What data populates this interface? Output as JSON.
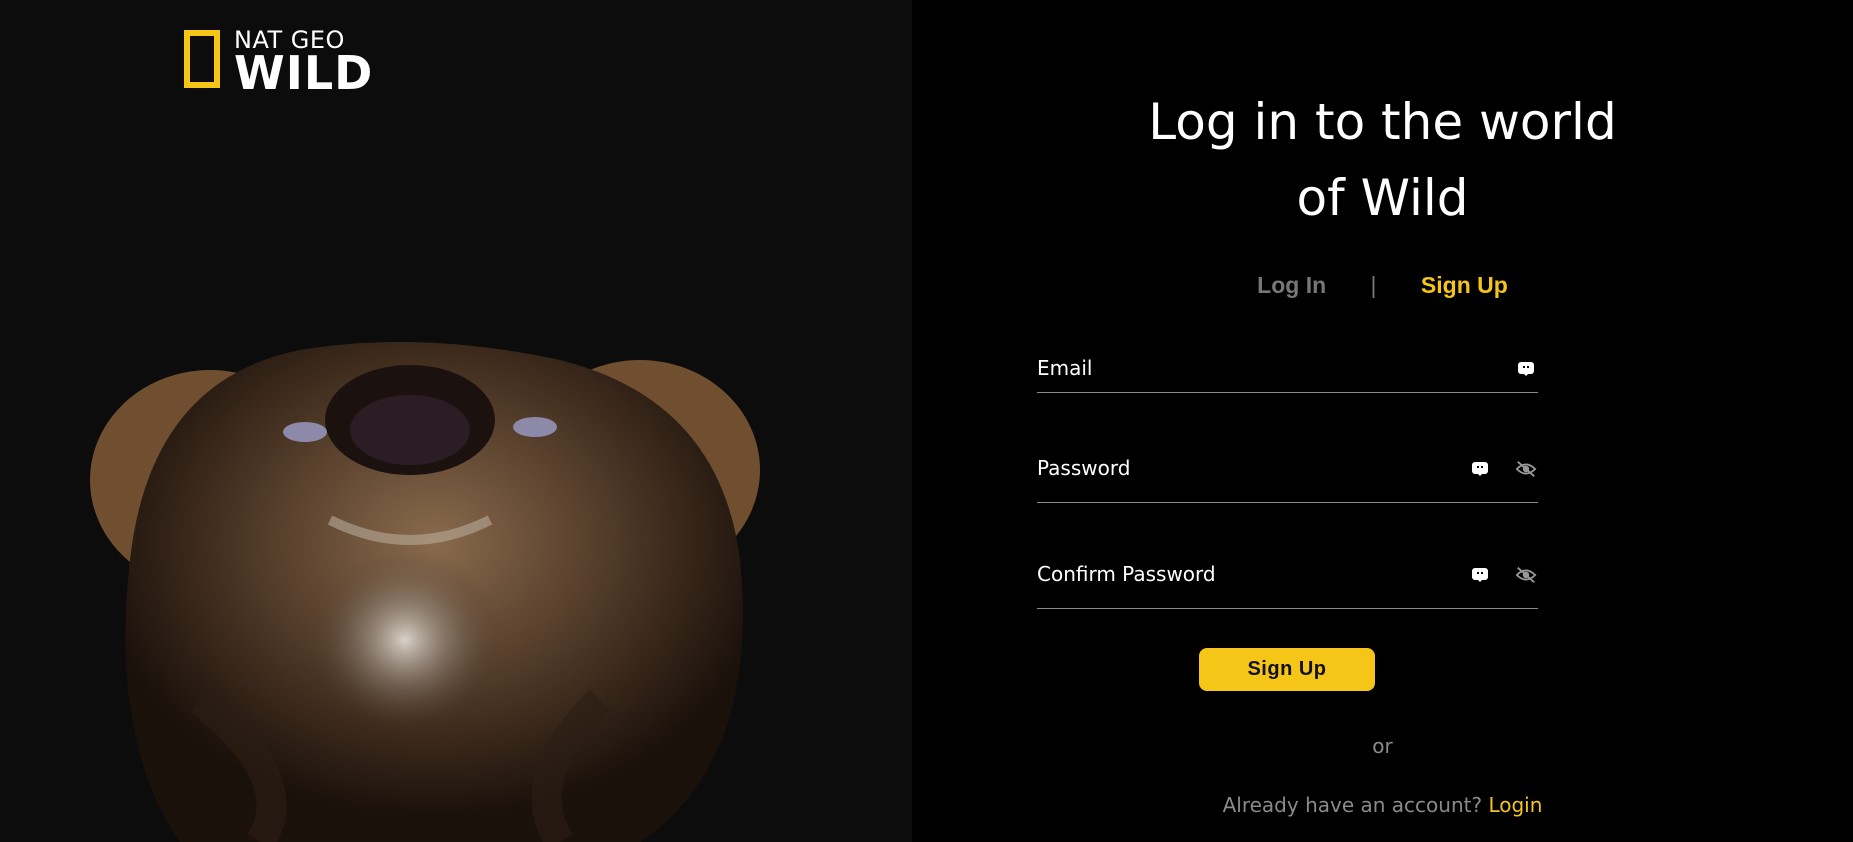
{
  "brand": {
    "logo_top": "NAT GEO",
    "logo_main": "WILD",
    "accent_color": "#f5c518"
  },
  "heading": {
    "line1": "Log in to the world",
    "line2": "of Wild"
  },
  "tabs": {
    "login": "Log In",
    "separator": "|",
    "signup": "Sign Up",
    "active": "signup"
  },
  "form": {
    "email_placeholder": "Email",
    "password_placeholder": "Password",
    "confirm_placeholder": "Confirm Password",
    "submit_label": "Sign Up",
    "field_icon": "keyboard-badge-icon",
    "toggle_icon": "eye-slash-icon"
  },
  "footer": {
    "or_text": "or",
    "already_text": "Already have an account?",
    "login_link": "Login"
  }
}
